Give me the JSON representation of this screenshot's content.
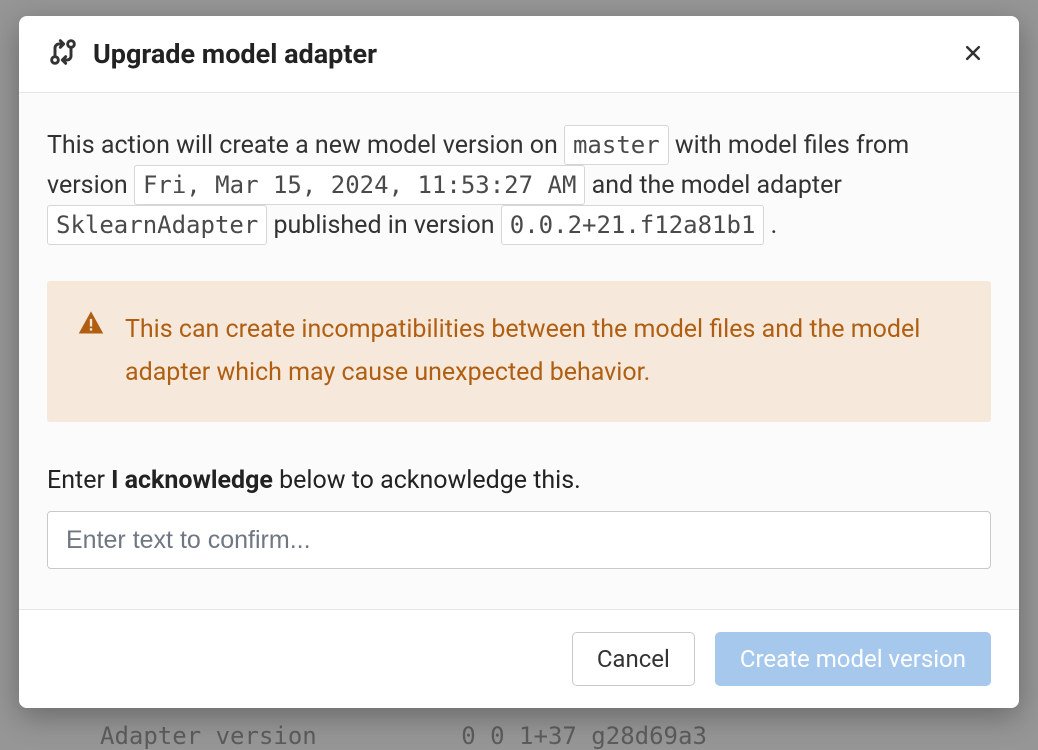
{
  "background": {
    "field_label": "Adapter version",
    "field_value": "0  0  1+37  g28d69a3"
  },
  "modal": {
    "title": "Upgrade model adapter",
    "description": {
      "part1": "This action will create a new model version on ",
      "branch": "master",
      "part2": " with model files from version ",
      "version_date": "Fri, Mar 15, 2024, 11:53:27 AM",
      "part3": " and the model adapter ",
      "adapter": "SklearnAdapter",
      "part4": " published in version ",
      "adapter_version": "0.0.2+21.f12a81b1",
      "part5": " ."
    },
    "warning": "This can create incompatibilities between the model files and the model adapter which may cause unexpected behavior.",
    "ack": {
      "prefix": "Enter ",
      "phrase": "I acknowledge",
      "suffix": " below to acknowledge this."
    },
    "input_placeholder": "Enter text to confirm...",
    "buttons": {
      "cancel": "Cancel",
      "confirm": "Create model version"
    }
  }
}
